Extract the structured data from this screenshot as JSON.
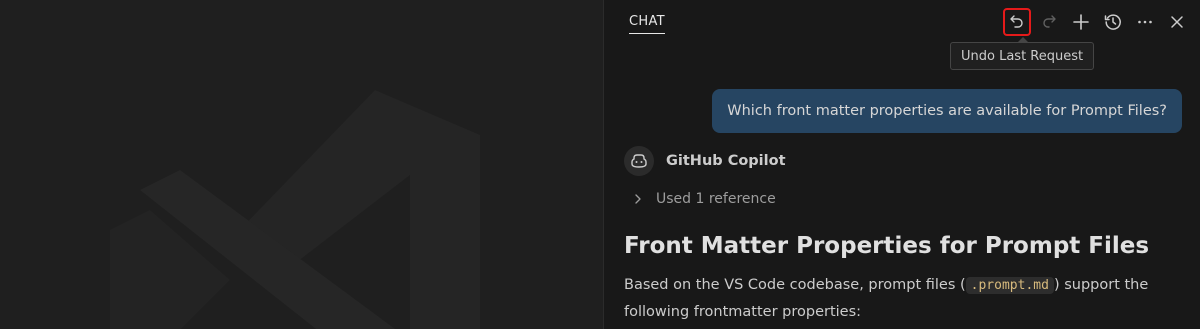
{
  "chat": {
    "tab_label": "CHAT",
    "toolbar": {
      "undo": "undo-icon",
      "redo": "redo-icon",
      "new_chat": "plus-icon",
      "history": "history-icon",
      "more": "ellipsis-icon",
      "close": "close-icon"
    },
    "tooltip": "Undo Last Request",
    "user_message": "Which front matter properties are available for Prompt Files?",
    "assistant_name": "GitHub Copilot",
    "reference_label": "Used 1 reference",
    "answer": {
      "heading": "Front Matter Properties for Prompt Files",
      "para_before": "Based on the VS Code codebase, prompt files (",
      "code": ".prompt.md",
      "para_after": ") support the following frontmatter properties:"
    }
  },
  "colors": {
    "panel_bg": "#181818",
    "editor_bg": "#1f1f1f",
    "user_bubble": "#264562",
    "highlight": "#e51a1a",
    "code_text": "#d7ba7d"
  }
}
